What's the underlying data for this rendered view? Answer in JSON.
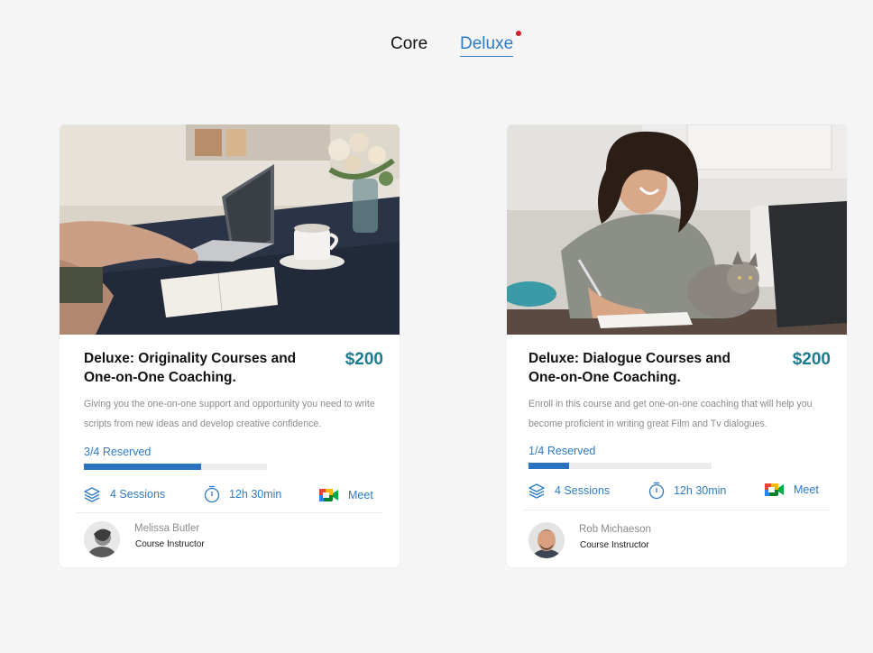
{
  "tabs": {
    "core_label": "Core",
    "deluxe_label": "Deluxe",
    "active": "Deluxe"
  },
  "colors": {
    "accent_blue": "#2e7bc4",
    "price_teal": "#1c7c8c",
    "notification_dot": "#d81e2c",
    "background": "#f5f5f6"
  },
  "courses": [
    {
      "title": "Deluxe: Originality Courses and One-on-One Coaching.",
      "price": "$200",
      "description": "Giving you the one-on-one support and opportunity you need to write scripts from new ideas and develop creative confidence.",
      "reserved_label": "3/4 Reserved",
      "reserved_fraction": 0.64,
      "sessions": "4 Sessions",
      "duration": "12h 30min",
      "platform": "Meet",
      "instructor_name": "Melissa Butler",
      "instructor_role": "Course Instructor",
      "icons": [
        "layers-icon",
        "timer-icon",
        "google-meet-icon"
      ]
    },
    {
      "title": "Deluxe: Dialogue Courses and One-on-One Coaching.",
      "price": "$200",
      "description": "Enroll in this course and get one-on-one coaching that will help you become proficient in writing great Film and Tv dialogues.",
      "reserved_label": "1/4 Reserved",
      "reserved_fraction": 0.22,
      "sessions": "4 Sessions",
      "duration": "12h 30min",
      "platform": "Meet",
      "instructor_name": "Rob Michaeson",
      "instructor_role": "Course Instructor",
      "icons": [
        "layers-icon",
        "timer-icon",
        "google-meet-icon"
      ]
    }
  ]
}
